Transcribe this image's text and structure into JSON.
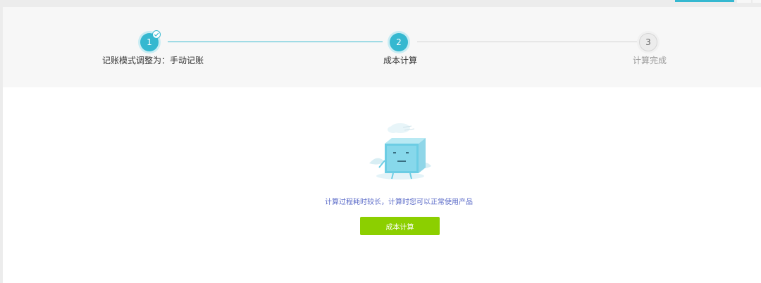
{
  "steps": [
    {
      "number": "1",
      "label": "记账模式调整为：手动记账",
      "status": "done"
    },
    {
      "number": "2",
      "label": "成本计算",
      "status": "active"
    },
    {
      "number": "3",
      "label": "计算完成",
      "status": "pending"
    }
  ],
  "main": {
    "hint": "计算过程耗时较长，计算时您可以正常使用产品",
    "button_label": "成本计算"
  },
  "colors": {
    "accent": "#35b8d0",
    "button": "#8ccf00",
    "hint": "#5b6bc8"
  }
}
